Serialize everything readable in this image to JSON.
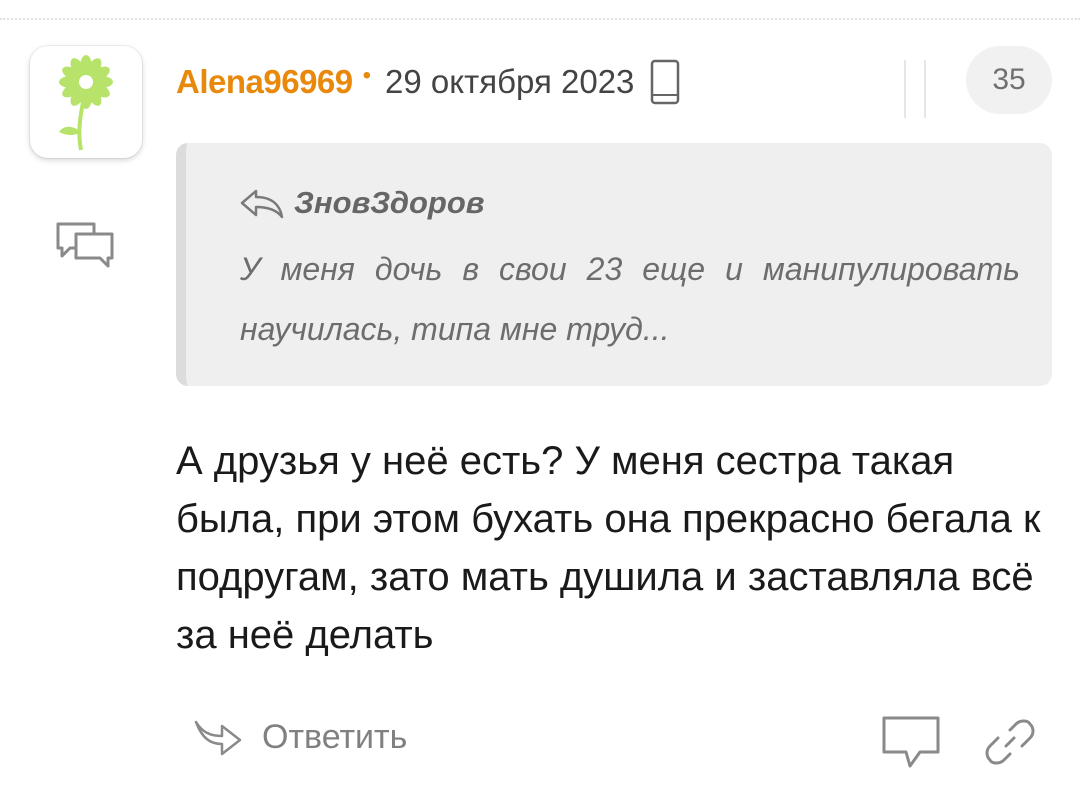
{
  "comment": {
    "username": "Alena96969",
    "separator": "•",
    "date": "29 октября 2023",
    "likes": "35",
    "quote": {
      "author": "ЗновЗдоров",
      "text": "У меня дочь в свои 23 еще и манипулировать научилась, типа мне труд..."
    },
    "body": "А друзья у неё есть? У меня сестра такая была, при этом бухать она прекрасно бегала к подругам, зато мать душила и заставляла всё за неё делать",
    "reply_label": "Ответить"
  },
  "colors": {
    "accent": "#e8890c",
    "avatar_flower": "#b7e36b",
    "quote_bg": "#efefef",
    "icon_gray": "#8a8a8a"
  },
  "icons": {
    "avatar": "green-flower-avatar",
    "device": "mobile-phone-icon",
    "replies": "speech-bubbles-icon",
    "quote_author": "reply-arrow-icon",
    "reply": "reply-arrow-icon",
    "comment": "speech-bubble-icon",
    "link": "link-icon"
  }
}
